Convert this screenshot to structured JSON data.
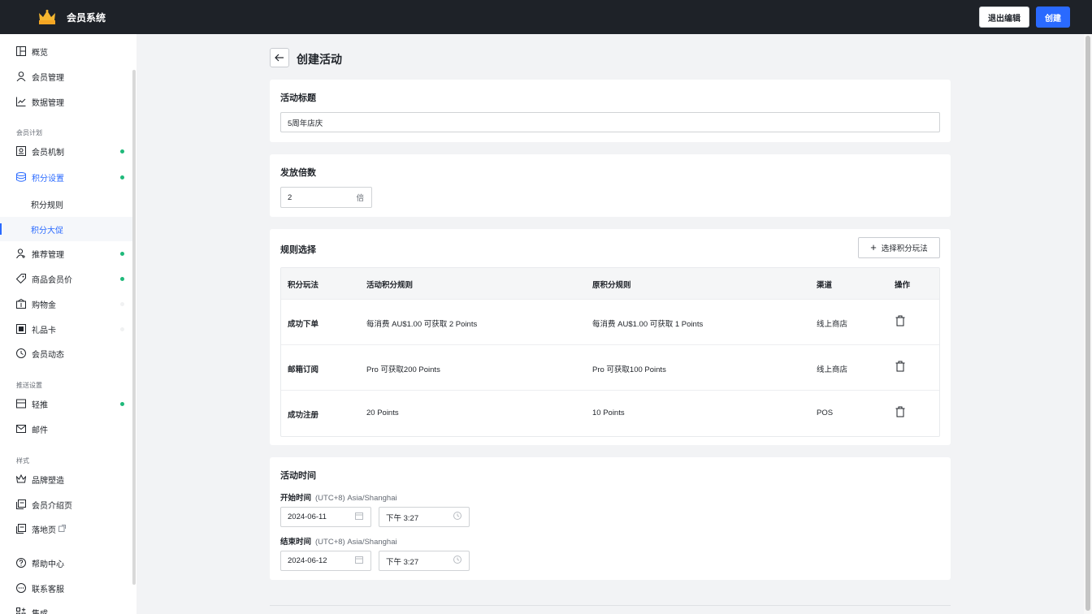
{
  "app": {
    "title": "会员系统"
  },
  "header": {
    "exit_label": "退出编辑",
    "create_label": "创建"
  },
  "sidebar": {
    "items": [
      {
        "label": "概览",
        "icon": "layout-icon"
      },
      {
        "label": "会员管理",
        "icon": "user-icon"
      },
      {
        "label": "数据管理",
        "icon": "chart-icon"
      },
      {
        "label": "会员机制",
        "icon": "id-card-icon"
      },
      {
        "label": "积分设置",
        "icon": "database-icon"
      },
      {
        "label": "积分规则"
      },
      {
        "label": "积分大促"
      },
      {
        "label": "推荐管理",
        "icon": "user-add-icon"
      },
      {
        "label": "商品会员价",
        "icon": "tag-icon"
      },
      {
        "label": "购物金",
        "icon": "wallet-icon"
      },
      {
        "label": "礼品卡",
        "icon": "gift-card-icon"
      },
      {
        "label": "会员动态",
        "icon": "clock-icon"
      },
      {
        "label": "轻推",
        "icon": "push-icon"
      },
      {
        "label": "邮件",
        "icon": "mail-icon"
      },
      {
        "label": "品牌塑造",
        "icon": "crown-icon"
      },
      {
        "label": "会员介绍页",
        "icon": "page-icon"
      },
      {
        "label": "落地页",
        "icon": "page-icon"
      },
      {
        "label": "帮助中心",
        "icon": "help-icon"
      },
      {
        "label": "联系客服",
        "icon": "chat-icon"
      },
      {
        "label": "集成",
        "icon": "integration-icon"
      }
    ],
    "groups": {
      "plan": "会员计划",
      "push": "推送设置",
      "style": "样式"
    }
  },
  "page": {
    "title": "创建活动"
  },
  "title_card": {
    "label": "活动标题",
    "value": "5周年店庆"
  },
  "multiplier_card": {
    "label": "发放倍数",
    "value": "2",
    "suffix": "倍"
  },
  "rules_card": {
    "label": "规则选择",
    "add_button": "选择积分玩法",
    "columns": [
      "积分玩法",
      "活动积分规则",
      "原积分规则",
      "渠道",
      "操作"
    ],
    "rows": [
      {
        "type": "成功下单",
        "activity_rule": "每消费 AU$1.00 可获取 2 Points",
        "original_rule": "每消费 AU$1.00 可获取 1 Points",
        "channel": "线上商店"
      },
      {
        "type": "邮箱订阅",
        "activity_rule": "Pro 可获取200 Points",
        "original_rule": "Pro 可获取100 Points",
        "channel": "线上商店"
      },
      {
        "type": "成功注册",
        "activity_rule": "20 Points",
        "original_rule": "10 Points",
        "channel": "POS"
      }
    ]
  },
  "time_card": {
    "label": "活动时间",
    "start": {
      "label": "开始时间",
      "timezone": "(UTC+8) Asia/Shanghai",
      "date": "2024-06-11",
      "time": "下午 3:27"
    },
    "end": {
      "label": "结束时间",
      "timezone": "(UTC+8) Asia/Shanghai",
      "date": "2024-06-12",
      "time": "下午 3:27"
    }
  },
  "colors": {
    "primary": "#2a6aff",
    "topbar": "#1e2228",
    "status_green": "#1fb97a"
  }
}
